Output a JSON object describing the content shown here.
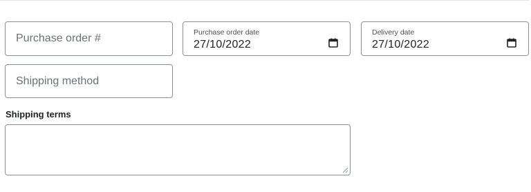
{
  "order": {
    "purchase_order_number": {
      "placeholder": "Purchase order #",
      "value": ""
    },
    "purchase_order_date": {
      "label": "Purchase order date",
      "value": "27/10/2022"
    },
    "delivery_date": {
      "label": "Delivery date",
      "value": "27/10/2022"
    },
    "shipping_method": {
      "placeholder": "Shipping method",
      "value": ""
    }
  },
  "shipping_terms": {
    "label": "Shipping terms",
    "value": ""
  },
  "icons": {
    "calendar": "calendar-icon",
    "resize": "resize-grip-icon"
  },
  "colors": {
    "border": "#8c9196",
    "placeholder": "#6d7175",
    "text": "#202223",
    "divider": "#e1e3e5"
  }
}
